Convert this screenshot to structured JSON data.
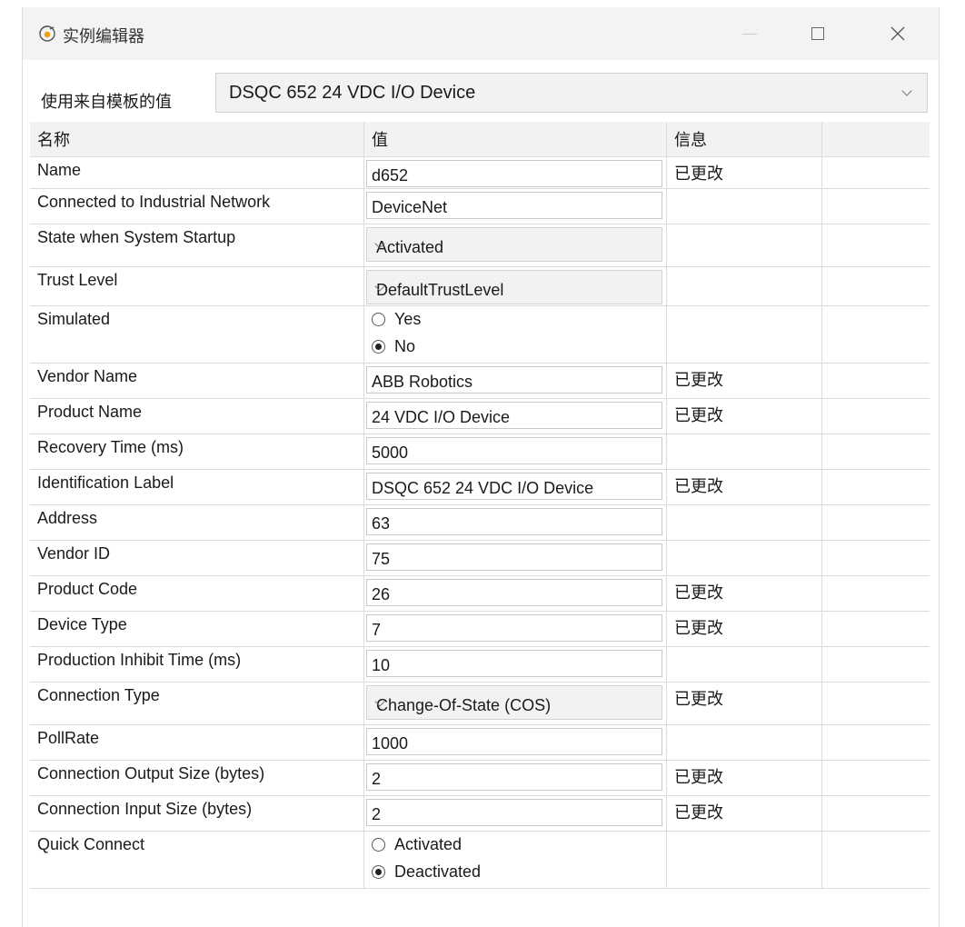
{
  "window": {
    "title": "实例编辑器"
  },
  "template": {
    "label": "使用来自模板的值",
    "selected": "DSQC 652 24 VDC I/O Device"
  },
  "grid": {
    "headers": [
      "名称",
      "值",
      "信息"
    ],
    "rows": [
      {
        "name": "Name",
        "type": "text",
        "value": "d652",
        "info": "已更改"
      },
      {
        "name": "Connected to Industrial Network",
        "type": "text",
        "value": "DeviceNet",
        "info": ""
      },
      {
        "name": "State when System Startup",
        "type": "select",
        "value": "Activated",
        "info": ""
      },
      {
        "name": "Trust Level",
        "type": "select",
        "value": "DefaultTrustLevel",
        "info": ""
      },
      {
        "name": "Simulated",
        "type": "radio",
        "options": [
          "Yes",
          "No"
        ],
        "selected": "No",
        "info": ""
      },
      {
        "name": "Vendor Name",
        "type": "text",
        "value": "ABB Robotics",
        "info": "已更改"
      },
      {
        "name": "Product Name",
        "type": "text",
        "value": "24 VDC I/O Device",
        "info": "已更改"
      },
      {
        "name": "Recovery Time (ms)",
        "type": "text",
        "value": "5000",
        "info": ""
      },
      {
        "name": "Identification Label",
        "type": "text",
        "value": "DSQC 652 24 VDC I/O Device",
        "info": "已更改"
      },
      {
        "name": "Address",
        "type": "text",
        "value": "63",
        "info": ""
      },
      {
        "name": "Vendor ID",
        "type": "text",
        "value": "75",
        "info": ""
      },
      {
        "name": "Product Code",
        "type": "text",
        "value": "26",
        "info": "已更改"
      },
      {
        "name": "Device Type",
        "type": "text",
        "value": "7",
        "info": "已更改"
      },
      {
        "name": "Production Inhibit Time (ms)",
        "type": "text",
        "value": "10",
        "info": ""
      },
      {
        "name": "Connection Type",
        "type": "select",
        "value": "Change-Of-State (COS)",
        "info": "已更改"
      },
      {
        "name": "PollRate",
        "type": "text",
        "value": "1000",
        "info": ""
      },
      {
        "name": "Connection Output Size (bytes)",
        "type": "text",
        "value": "2",
        "info": "已更改"
      },
      {
        "name": "Connection Input Size (bytes)",
        "type": "text",
        "value": "2",
        "info": "已更改"
      },
      {
        "name": "Quick Connect",
        "type": "radio",
        "options": [
          "Activated",
          "Deactivated"
        ],
        "selected": "Deactivated",
        "info": ""
      }
    ]
  }
}
